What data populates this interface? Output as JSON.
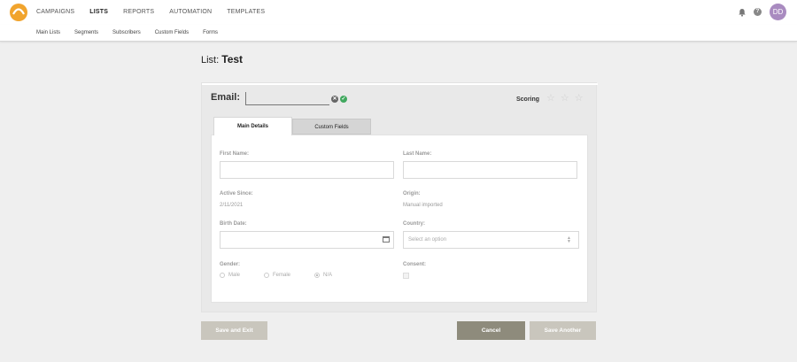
{
  "topnav": {
    "items": [
      "CAMPAIGNS",
      "LISTS",
      "REPORTS",
      "AUTOMATION",
      "TEMPLATES"
    ],
    "active_index": 1,
    "help_label": "?",
    "avatar_initials": "DD",
    "colors": {
      "logo": "#f1a42d",
      "avatar": "#a98bc0"
    }
  },
  "subnav": {
    "items": [
      "Main Lists",
      "Segments",
      "Subscribers",
      "Custom Fields",
      "Forms"
    ]
  },
  "page": {
    "title_prefix": "List:",
    "list_name": "Test"
  },
  "card": {
    "email_label": "Email:",
    "email_value": "",
    "scoring_label": "Scoring",
    "scoring_stars_filled": 0,
    "scoring_stars_total": 3,
    "tabs": [
      {
        "label": "Main Details",
        "active": true
      },
      {
        "label": "Custom Fields",
        "active": false
      }
    ]
  },
  "form": {
    "first_name_label": "First Name:",
    "first_name_value": "",
    "last_name_label": "Last Name:",
    "last_name_value": "",
    "active_since_label": "Active Since:",
    "active_since_value": "2/11/2021",
    "origin_label": "Origin:",
    "origin_value": "Manual imported",
    "birth_date_label": "Birth Date:",
    "birth_date_value": "",
    "country_label": "Country:",
    "country_placeholder": "Select an option",
    "gender_label": "Gender:",
    "gender_options": [
      "Male",
      "Female",
      "N/A"
    ],
    "gender_selected": "N/A",
    "consent_label": "Consent:",
    "consent_checked": false
  },
  "actions": {
    "save_exit_label": "Save and Exit",
    "cancel_label": "Cancel",
    "save_another_label": "Save Another",
    "colors": {
      "primary": "#8e8b7c",
      "disabled": "#c9c6bd"
    }
  }
}
